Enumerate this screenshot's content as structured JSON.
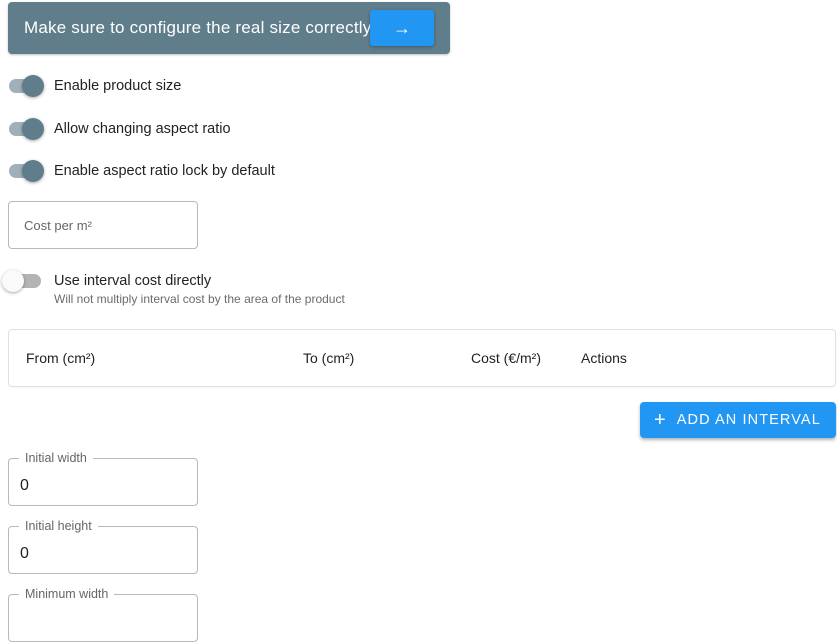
{
  "banner": {
    "text": "Make sure to configure the real size correctly",
    "button_label": "→"
  },
  "toggles": [
    {
      "label": "Enable product size",
      "on": true
    },
    {
      "label": "Allow changing aspect ratio",
      "on": true
    },
    {
      "label": "Enable aspect ratio lock by default",
      "on": true
    }
  ],
  "cost_field": {
    "placeholder": "Cost per m²"
  },
  "interval_toggle": {
    "label": "Use interval cost directly",
    "helper": "Will not multiply interval cost by the area of the product",
    "on": false
  },
  "interval_table": {
    "columns": [
      "From (cm²)",
      "To (cm²)",
      "Cost (€/m²)",
      "Actions"
    ]
  },
  "add_interval_button": {
    "icon": "plus-icon",
    "label": "ADD AN INTERVAL"
  },
  "size_fields": [
    {
      "label": "Initial width",
      "value": "0"
    },
    {
      "label": "Initial height",
      "value": "0"
    },
    {
      "label": "Minimum width",
      "value": ""
    }
  ],
  "colors": {
    "primary": "#2196f3",
    "banner": "#607d8b"
  }
}
